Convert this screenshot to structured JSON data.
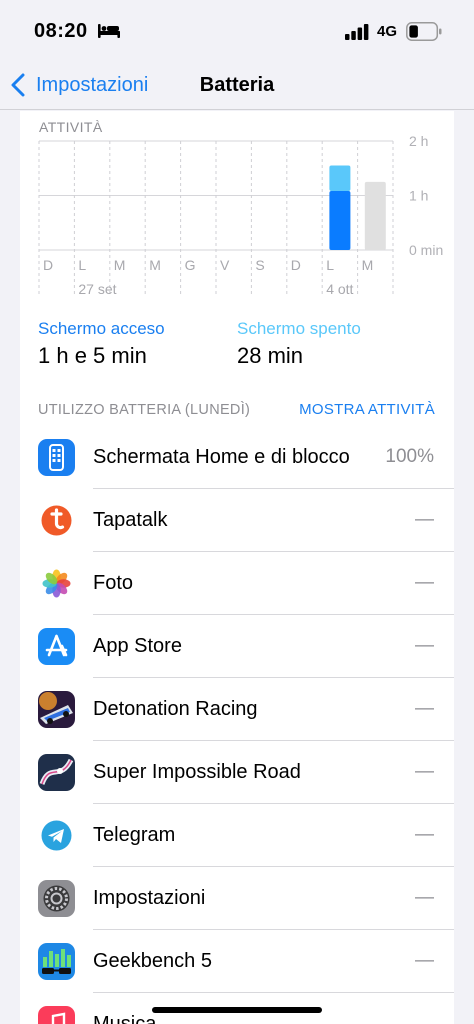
{
  "status_bar": {
    "time": "08:20",
    "network": "4G",
    "icons": [
      "bed-icon",
      "signal-icon",
      "battery-icon"
    ]
  },
  "nav": {
    "back_label": "Impostazioni",
    "title": "Batteria"
  },
  "activity": {
    "label": "ATTIVITÀ",
    "chart_data": {
      "type": "bar",
      "categories": [
        "D",
        "L",
        "M",
        "M",
        "G",
        "V",
        "S",
        "D",
        "L",
        "M"
      ],
      "date_labels": [
        {
          "index": 1,
          "text": "27 set"
        },
        {
          "index": 8,
          "text": "4 ott"
        }
      ],
      "series": [
        {
          "name": "Schermo acceso",
          "color": "#0a7cff",
          "values": [
            0,
            0,
            0,
            0,
            0,
            0,
            0,
            0,
            65,
            0
          ]
        },
        {
          "name": "Schermo spento",
          "color": "#5ac8fa",
          "values": [
            0,
            0,
            0,
            0,
            0,
            0,
            0,
            0,
            28,
            0
          ]
        },
        {
          "name": "",
          "color": "#e0e0e0",
          "values": [
            0,
            0,
            0,
            0,
            0,
            0,
            0,
            0,
            0,
            75
          ]
        }
      ],
      "y_ticks": [
        "2 h",
        "1 h",
        "0 min"
      ],
      "ylim": [
        0,
        120
      ],
      "stacked": true
    }
  },
  "screen_stats": {
    "on_label": "Schermo acceso",
    "on_value": "1 h e 5 min",
    "off_label": "Schermo spento",
    "off_value": "28 min"
  },
  "usage": {
    "title": "UTILIZZO BATTERIA (LUNEDÌ)",
    "show_activity": "MOSTRA ATTIVITÀ",
    "apps": [
      {
        "name": "Schermata Home e di blocco",
        "value": "100%",
        "icon": "home-screen-icon"
      },
      {
        "name": "Tapatalk",
        "value": "—",
        "icon": "tapatalk-icon"
      },
      {
        "name": "Foto",
        "value": "—",
        "icon": "photos-icon"
      },
      {
        "name": "App Store",
        "value": "—",
        "icon": "app-store-icon"
      },
      {
        "name": "Detonation Racing",
        "value": "—",
        "icon": "detonation-racing-icon"
      },
      {
        "name": "Super Impossible Road",
        "value": "—",
        "icon": "super-impossible-road-icon"
      },
      {
        "name": "Telegram",
        "value": "—",
        "icon": "telegram-icon"
      },
      {
        "name": "Impostazioni",
        "value": "—",
        "icon": "settings-icon"
      },
      {
        "name": "Geekbench 5",
        "value": "—",
        "icon": "geekbench-icon"
      },
      {
        "name": "Musica",
        "value": "",
        "icon": "music-icon"
      }
    ]
  }
}
